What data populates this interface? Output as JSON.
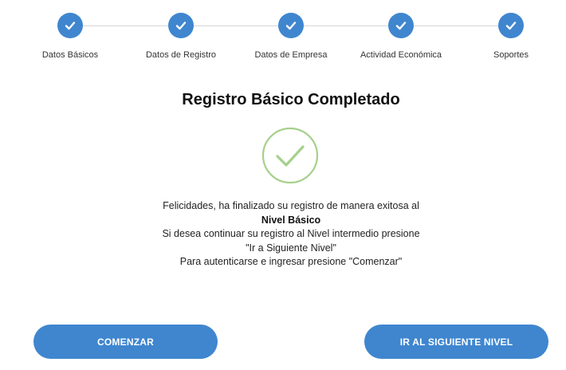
{
  "stepper": {
    "steps": [
      {
        "label": "Datos Básicos",
        "status": "completed",
        "icon": "check-icon"
      },
      {
        "label": "Datos de Registro",
        "status": "completed",
        "icon": "check-icon"
      },
      {
        "label": "Datos de Empresa",
        "status": "completed",
        "icon": "check-icon"
      },
      {
        "label": "Actividad Económica",
        "status": "completed",
        "icon": "check-icon"
      },
      {
        "label": "Soportes",
        "status": "completed",
        "icon": "check-icon"
      }
    ]
  },
  "main": {
    "title": "Registro Básico Completado",
    "success_icon": "check-circle-icon",
    "message": {
      "line1": "Felicidades, ha finalizado su registro de manera exitosa al",
      "line2": "Nivel Básico",
      "line3": "Si desea continuar su registro al Nivel intermedio presione",
      "line4": "\"Ir a Siguiente Nivel\"",
      "line5": "Para autenticarse e ingresar presione \"Comenzar\""
    }
  },
  "actions": {
    "start_label": "COMENZAR",
    "next_level_label": "IR AL SIGUIENTE NIVEL"
  },
  "colors": {
    "accent": "#3f86cf",
    "success": "#a7d08c",
    "connector": "#d6d6d6"
  }
}
